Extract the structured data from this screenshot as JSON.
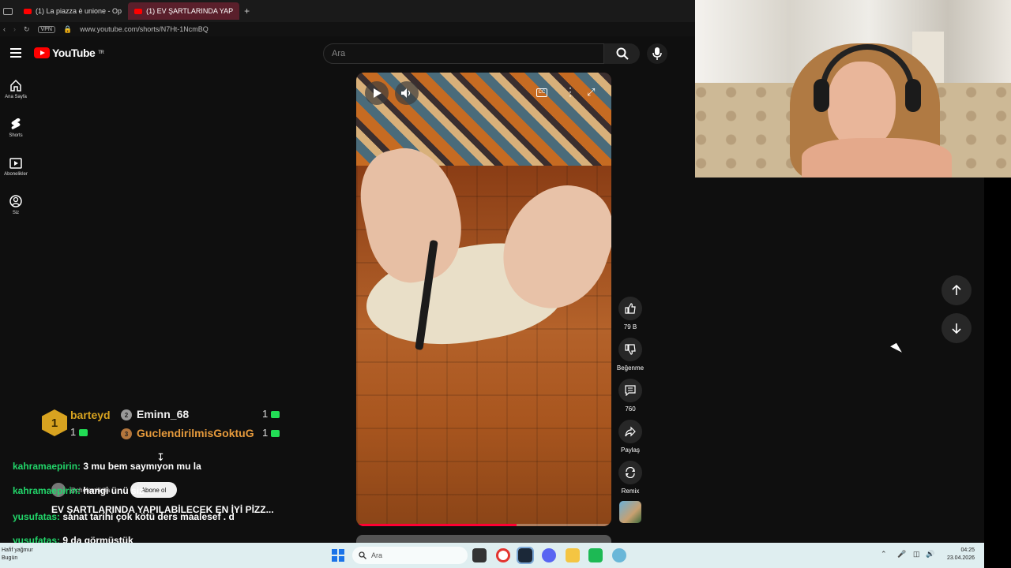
{
  "browser": {
    "tabs": [
      {
        "label": "(1) La piazza è unione - Op"
      },
      {
        "label": "(1) EV ŞARTLARINDA YAP"
      }
    ],
    "new_tab": "+",
    "vpn": "VPN",
    "url": "www.youtube.com/shorts/N7Ht-1NcmBQ"
  },
  "youtube": {
    "logo": "YouTube",
    "region": "TR",
    "search_placeholder": "Ara",
    "nav": [
      {
        "label": "Ana Sayfa",
        "icon": "home-icon"
      },
      {
        "label": "Shorts",
        "icon": "shorts-icon"
      },
      {
        "label": "Abonelikler",
        "icon": "subscriptions-icon"
      },
      {
        "label": "Siz",
        "icon": "account-icon"
      }
    ],
    "actions": {
      "like": "79 B",
      "dislike": "Beğenme",
      "comments": "760",
      "share": "Paylaş",
      "remix": "Remix"
    },
    "video_progress": 0.63,
    "short_title": "EV ŞARTLARINDA YAPILABİLECEK EN İYİ PİZZ...",
    "channel": "@chefsmilkilla",
    "subscribe": "Abone ol"
  },
  "overlay": {
    "leader": {
      "rank": "1",
      "name": "barteyd",
      "count": "1"
    },
    "second": {
      "rank": "2",
      "name": "Eminn_68",
      "count": "1"
    },
    "third": {
      "rank": "3",
      "name": "GuclendirilmisGoktuG",
      "count": "1"
    },
    "chat": [
      {
        "user": "kahramaepirin:",
        "msg": "3 mu bem saymıyon mu la"
      },
      {
        "user": "kahramaepirin:",
        "msg": "hangi ünü siz"
      },
      {
        "user": "yusufatas:",
        "msg": "sanat tarihi çok kötü ders maalesef . d"
      },
      {
        "user": "yusufatas:",
        "msg": "9 da görmüştük"
      }
    ]
  },
  "taskbar": {
    "weather_line1": "Hafif yağmur",
    "weather_line2": "Bugün",
    "search": "Ara",
    "time": "04:25",
    "date": "23.04.2026"
  },
  "colors": {
    "accent": "#ff0000",
    "chat_user": "#22d66a",
    "taskbar": "#dfeef0"
  }
}
